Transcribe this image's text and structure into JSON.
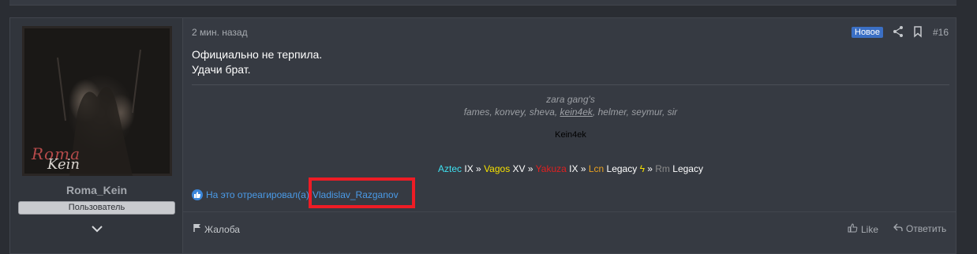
{
  "post": {
    "time": "2 мин. назад",
    "new_badge": "Новое",
    "number": "#16",
    "body_lines": [
      "Официально не терпила.",
      "Удачи брат."
    ],
    "signature": {
      "line1": "zara gang's",
      "line2_before": "fames, konvey, sheva, ",
      "line2_underlined": "kein4ek",
      "line2_after": ", helmer, seymur, sir",
      "nick": "Kein4ek",
      "gangs": {
        "aztec": "Aztec",
        "aztec_rank": " IX » ",
        "vagos": "Vagos",
        "vagos_rank": " XV » ",
        "yakuza": "Yakuza",
        "yakuza_rank": " IX » ",
        "lcn": "Lcn",
        "lcn_rank": " Legacy ",
        "lightning": "ϟ",
        "sep": " » ",
        "rm": "Rm",
        "rm_rank": " Legacy"
      }
    },
    "reaction": {
      "prefix": "На это отреагировал(а)",
      "user": "Vladislav_Razganov"
    },
    "actions": {
      "report": "Жалоба",
      "like": "Like",
      "reply": "Ответить"
    }
  },
  "author": {
    "username": "Roma_Kein",
    "role": "Пользователь",
    "avatar_text_1": "Roma",
    "avatar_text_2": "Kein"
  },
  "colors": {
    "badge_new": "#3b6fc4",
    "link": "#4a9be8",
    "highlight": "#ee1c25"
  }
}
